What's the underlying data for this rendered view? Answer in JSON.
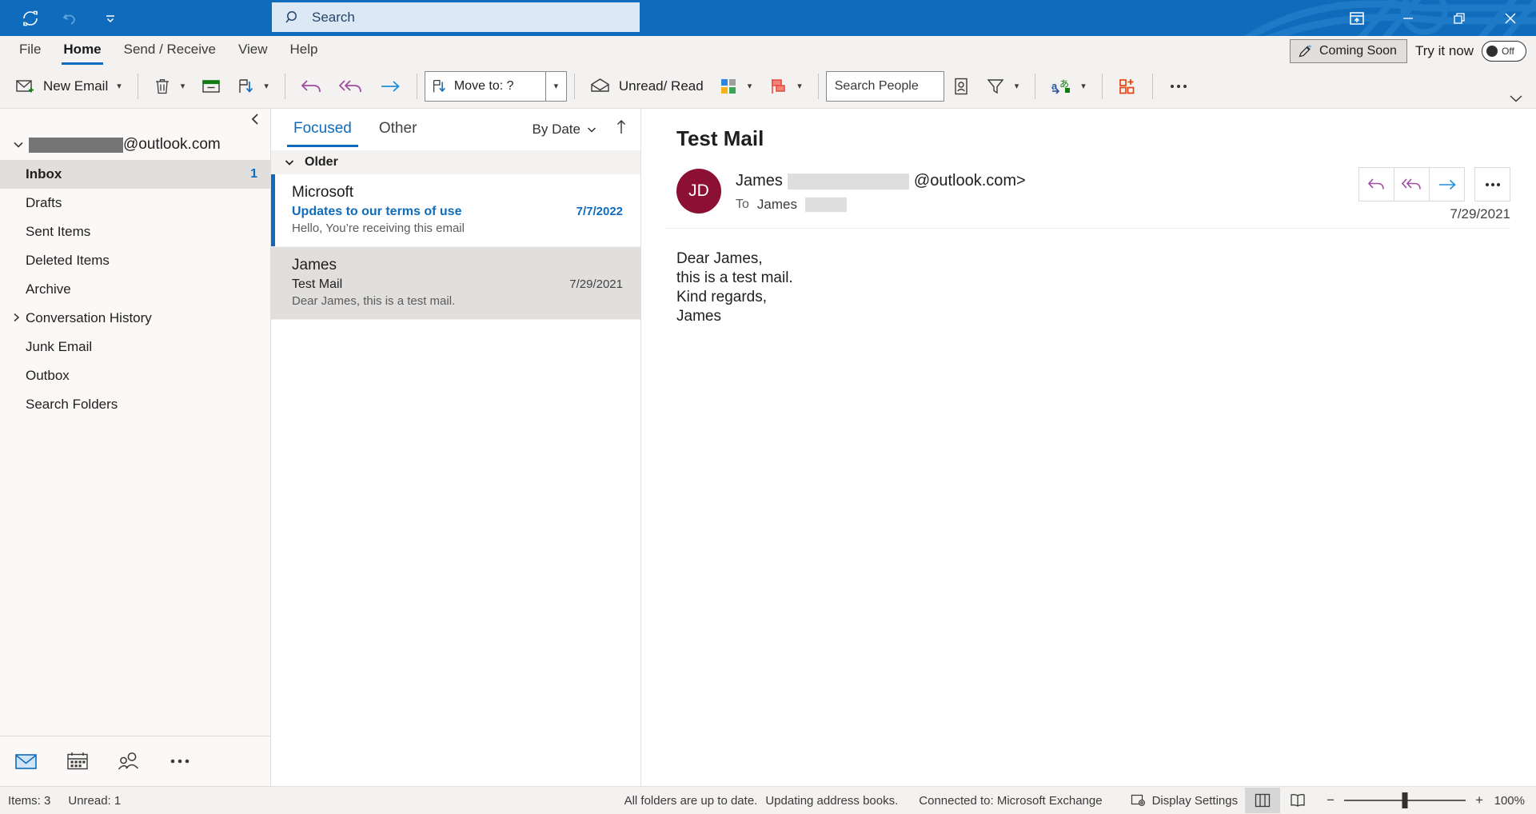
{
  "titlebar": {
    "quick_access": [
      {
        "name": "send-receive-all-icon",
        "label": "Send/Receive All Folders"
      },
      {
        "name": "undo-icon",
        "label": "Undo"
      },
      {
        "name": "customize-quick-access-toolbar-icon",
        "label": "Customize Quick Access Toolbar"
      }
    ],
    "search_placeholder": "Search",
    "search_value": "",
    "window_controls": [
      {
        "name": "ribbon-display-options-icon",
        "label": "Ribbon Display Options"
      },
      {
        "name": "minimize-icon",
        "label": "Minimize"
      },
      {
        "name": "restore-icon",
        "label": "Restore Down"
      },
      {
        "name": "close-icon",
        "label": "Close"
      }
    ]
  },
  "ribbon_tabs": [
    {
      "label": "File",
      "active": false
    },
    {
      "label": "Home",
      "active": true
    },
    {
      "label": "Send / Receive",
      "active": false
    },
    {
      "label": "View",
      "active": false
    },
    {
      "label": "Help",
      "active": false
    }
  ],
  "coming_soon": {
    "button_label": "Coming Soon",
    "try_label": "Try it now",
    "toggle_state": "Off"
  },
  "ribbon": {
    "new_email_label": "New Email",
    "move_to_label": "Move to: ?",
    "unread_read_label": "Unread/ Read",
    "search_people_placeholder": "Search People",
    "search_people_value": "",
    "commands": [
      {
        "name": "new-email-button",
        "label": "New Email",
        "icon": "new-email-icon"
      },
      {
        "name": "delete-button",
        "label": "",
        "icon": "trash-icon"
      },
      {
        "name": "archive-button",
        "label": "",
        "icon": "archive-icon"
      },
      {
        "name": "move-button",
        "label": "",
        "icon": "move-icon"
      },
      {
        "name": "reply-button",
        "label": "",
        "icon": "reply-icon"
      },
      {
        "name": "reply-all-button",
        "label": "",
        "icon": "reply-all-icon"
      },
      {
        "name": "forward-button",
        "label": "",
        "icon": "forward-icon"
      },
      {
        "name": "move-to-button",
        "label": "Move to: ?",
        "icon": "move-to-icon"
      },
      {
        "name": "unread-read-button",
        "label": "Unread/ Read",
        "icon": "envelope-icon"
      },
      {
        "name": "categorize-button",
        "label": "",
        "icon": "categorize-icon"
      },
      {
        "name": "follow-up-button",
        "label": "",
        "icon": "flag-icon"
      },
      {
        "name": "address-book-button",
        "label": "",
        "icon": "address-book-icon"
      },
      {
        "name": "filter-email-button",
        "label": "",
        "icon": "filter-icon"
      },
      {
        "name": "translate-button",
        "label": "",
        "icon": "translate-icon"
      },
      {
        "name": "get-addins-button",
        "label": "",
        "icon": "get-addins-icon"
      },
      {
        "name": "more-commands-button",
        "label": "",
        "icon": "ellipsis-icon"
      }
    ]
  },
  "folder_pane": {
    "account": {
      "name_redacted": true,
      "domain": "@outlook.com"
    },
    "folders": [
      {
        "label": "Inbox",
        "count": "1",
        "selected": true,
        "expandable": false
      },
      {
        "label": "Drafts",
        "count": "",
        "selected": false,
        "expandable": false
      },
      {
        "label": "Sent Items",
        "count": "",
        "selected": false,
        "expandable": false
      },
      {
        "label": "Deleted Items",
        "count": "",
        "selected": false,
        "expandable": false
      },
      {
        "label": "Archive",
        "count": "",
        "selected": false,
        "expandable": false
      },
      {
        "label": "Conversation History",
        "count": "",
        "selected": false,
        "expandable": true
      },
      {
        "label": "Junk Email",
        "count": "",
        "selected": false,
        "expandable": false
      },
      {
        "label": "Outbox",
        "count": "",
        "selected": false,
        "expandable": false
      },
      {
        "label": "Search Folders",
        "count": "",
        "selected": false,
        "expandable": false
      }
    ],
    "nav_items": [
      {
        "name": "nav-mail-icon",
        "label": "Mail",
        "active": true
      },
      {
        "name": "nav-calendar-icon",
        "label": "Calendar",
        "active": false
      },
      {
        "name": "nav-people-icon",
        "label": "People",
        "active": false
      },
      {
        "name": "nav-more-icon",
        "label": "More",
        "active": false
      }
    ]
  },
  "message_list": {
    "tabs": [
      {
        "label": "Focused",
        "active": true
      },
      {
        "label": "Other",
        "active": false
      }
    ],
    "sort_label": "By Date",
    "group_label": "Older",
    "messages": [
      {
        "from": "Microsoft",
        "subject": "Updates to our terms of use",
        "date": "7/7/2022",
        "preview": "Hello, You’re receiving this email",
        "unread": true,
        "selected": false
      },
      {
        "from": "James",
        "subject": "Test Mail",
        "date": "7/29/2021",
        "preview": "Dear James,  this is a test mail.",
        "unread": false,
        "selected": true
      }
    ]
  },
  "reading_pane": {
    "subject": "Test Mail",
    "avatar_initials": "JD",
    "sender_name": "James",
    "sender_domain": "@outlook.com>",
    "to_label": "To",
    "to_name": "James",
    "date": "7/29/2021",
    "body_lines": [
      "Dear James,",
      "this is a test mail.",
      "Kind regards,",
      "James"
    ],
    "actions": [
      {
        "name": "reply-button",
        "label": "Reply"
      },
      {
        "name": "reply-all-button",
        "label": "Reply All"
      },
      {
        "name": "forward-button",
        "label": "Forward"
      },
      {
        "name": "more-actions-button",
        "label": "More actions"
      }
    ]
  },
  "status_bar": {
    "items_label": "Items: 3",
    "unread_label": "Unread: 1",
    "sync_status": "All folders are up to date.",
    "update_status": "Updating address books.",
    "connection": "Connected to: Microsoft Exchange",
    "display_settings": "Display Settings",
    "zoom_value": "100%",
    "zoom_minus": "−",
    "zoom_plus": "+"
  },
  "colors": {
    "accent": "#0f6cbd",
    "titlebar": "#0f6cbd",
    "ribbon_bg": "#f3f2f1",
    "avatar": "#8b1033",
    "selection": "#e1dfdd",
    "reply_purple": "#a04ca0",
    "forward_blue": "#1e90d8",
    "addins_orange": "#e8430f"
  }
}
